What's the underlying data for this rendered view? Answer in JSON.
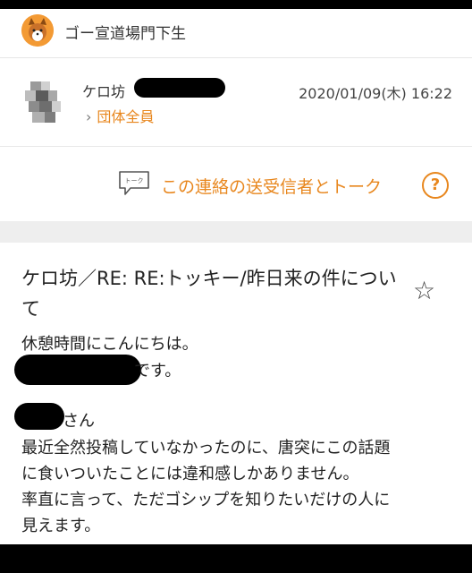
{
  "header": {
    "group_name": "ゴー宣道場門下生"
  },
  "sender": {
    "name": "ケロ坊",
    "group_link": "団体全員",
    "date": "2020/01/09(木) 16:22"
  },
  "talk": {
    "icon_text": "トーク",
    "label": "この連絡の送受信者とトーク",
    "help": "?"
  },
  "message": {
    "subject": "ケロ坊／RE: RE:トッキー/昨日来の件について",
    "lines": {
      "l1": "休憩時間にこんにちは。",
      "l2": "です。",
      "l3": "さん",
      "l4": "最近全然投稿していなかったのに、唐突にこの話題",
      "l5": "に食いついたことには違和感しかありません。",
      "l6": "率直に言って、ただゴシップを知りたいだけの人に",
      "l7": "見えます。"
    }
  },
  "colors": {
    "accent": "#e8871e",
    "separator": "#eeeeee"
  },
  "icons": {
    "star": "star-outline-icon",
    "help": "question-circle-icon",
    "talk": "chat-bubble-icon"
  }
}
